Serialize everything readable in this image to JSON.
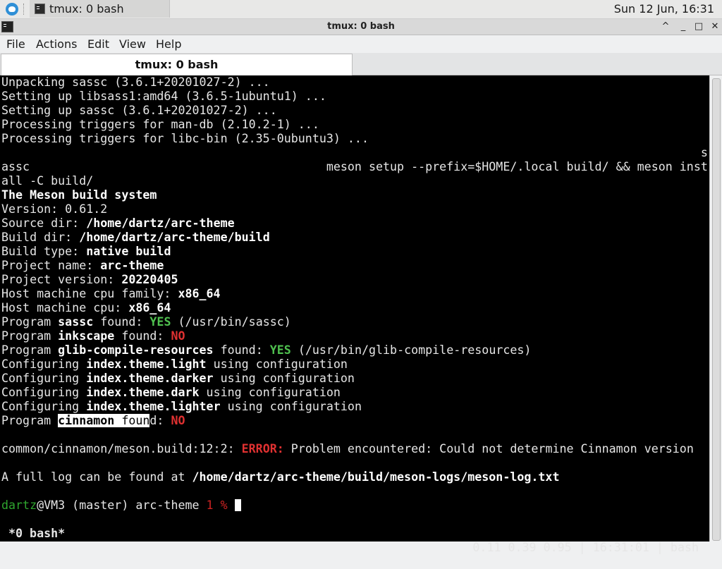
{
  "taskbar": {
    "task_label": "tmux: 0 bash",
    "clock": "Sun 12 Jun, 16:31"
  },
  "window": {
    "title": "tmux: 0 bash",
    "controls": [
      "^",
      "_",
      "□",
      "✕"
    ]
  },
  "menu": [
    "File",
    "Actions",
    "Edit",
    "View",
    "Help"
  ],
  "tab": {
    "label": "tmux: 0 bash"
  },
  "terminal": {
    "lines": [
      [
        {
          "t": "Unpacking sassc (3.6.1+20201027-2) ..."
        }
      ],
      [
        {
          "t": "Setting up libsass1:amd64 (3.6.5-1ubuntu1) ..."
        }
      ],
      [
        {
          "t": "Setting up sassc (3.6.1+20201027-2) ..."
        }
      ],
      [
        {
          "t": "Processing triggers for man-db (2.10.2-1) ..."
        }
      ],
      [
        {
          "t": "Processing triggers for libc-bin (2.35-0ubuntu3) ..."
        }
      ],
      [
        {
          "t": "                                                                                                   s"
        }
      ],
      [
        {
          "t": "assc                                          meson setup --prefix=$HOME/.local build/ && meson inst"
        }
      ],
      [
        {
          "t": "all -C build/"
        }
      ],
      [
        {
          "t": "The Meson build system",
          "c": "b"
        }
      ],
      [
        {
          "t": "Version: 0.61.2"
        }
      ],
      [
        {
          "t": "Source dir: "
        },
        {
          "t": "/home/dartz/arc-theme",
          "c": "b"
        }
      ],
      [
        {
          "t": "Build dir: "
        },
        {
          "t": "/home/dartz/arc-theme/build",
          "c": "b"
        }
      ],
      [
        {
          "t": "Build type: "
        },
        {
          "t": "native build",
          "c": "b"
        }
      ],
      [
        {
          "t": "Project name: "
        },
        {
          "t": "arc-theme",
          "c": "b"
        }
      ],
      [
        {
          "t": "Project version: "
        },
        {
          "t": "20220405",
          "c": "b"
        }
      ],
      [
        {
          "t": "Host machine cpu family: "
        },
        {
          "t": "x86_64",
          "c": "b"
        }
      ],
      [
        {
          "t": "Host machine cpu: "
        },
        {
          "t": "x86_64",
          "c": "b"
        }
      ],
      [
        {
          "t": "Program "
        },
        {
          "t": "sassc",
          "c": "b"
        },
        {
          "t": " found: "
        },
        {
          "t": "YES",
          "c": "green"
        },
        {
          "t": " (/usr/bin/sassc)"
        }
      ],
      [
        {
          "t": "Program "
        },
        {
          "t": "inkscape",
          "c": "b"
        },
        {
          "t": " found: "
        },
        {
          "t": "NO",
          "c": "red"
        }
      ],
      [
        {
          "t": "Program "
        },
        {
          "t": "glib-compile-resources",
          "c": "b"
        },
        {
          "t": " found: "
        },
        {
          "t": "YES",
          "c": "green"
        },
        {
          "t": " (/usr/bin/glib-compile-resources)"
        }
      ],
      [
        {
          "t": "Configuring "
        },
        {
          "t": "index.theme.light",
          "c": "b"
        },
        {
          "t": " using configuration"
        }
      ],
      [
        {
          "t": "Configuring "
        },
        {
          "t": "index.theme.darker",
          "c": "b"
        },
        {
          "t": " using configuration"
        }
      ],
      [
        {
          "t": "Configuring "
        },
        {
          "t": "index.theme.dark",
          "c": "b"
        },
        {
          "t": " using configuration"
        }
      ],
      [
        {
          "t": "Configuring "
        },
        {
          "t": "index.theme.lighter",
          "c": "b"
        },
        {
          "t": " using configuration"
        }
      ],
      [
        {
          "t": "Program "
        },
        {
          "t": "cinnamon",
          "c": "inv"
        },
        {
          "t": " foun",
          "c": "inv2"
        },
        {
          "t": "d: "
        },
        {
          "t": "NO",
          "c": "red"
        }
      ],
      [
        {
          "t": ""
        }
      ],
      [
        {
          "t": "common/cinnamon/meson.build:12:2: "
        },
        {
          "t": "ERROR:",
          "c": "red"
        },
        {
          "t": " Problem encountered: Could not determine Cinnamon version"
        }
      ],
      [
        {
          "t": ""
        }
      ],
      [
        {
          "t": "A full log can be found at "
        },
        {
          "t": "/home/dartz/arc-theme/build/meson-logs/meson-log.txt",
          "c": "b"
        }
      ],
      [
        {
          "t": ""
        }
      ],
      [
        {
          "t": "dartz",
          "c": "dgreen"
        },
        {
          "t": "@VM3 (master) arc-theme "
        },
        {
          "t": "1 %",
          "c": "dred"
        },
        {
          "t": " "
        }
      ]
    ],
    "status_left": "*0 bash*",
    "status_right": "0.11 0.39 0.95 | 16:31:01 | bash"
  },
  "colors": {
    "terminal_bg": "#000000",
    "yes": "#4fc04f",
    "error": "#e03131",
    "prompt_user": "#2ea52e"
  }
}
